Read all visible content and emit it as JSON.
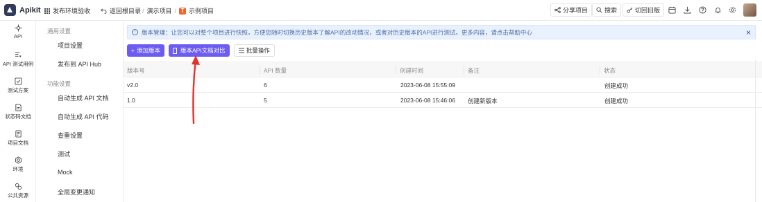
{
  "topbar": {
    "app_name": "Apikit",
    "env": "发布环境验收",
    "back": "返回根目录",
    "breadcrumb": [
      "演示项目",
      "示例项目"
    ],
    "project_badge": "T",
    "share": "分享项目",
    "search": "搜索",
    "old_version": "切回旧版"
  },
  "leftnav": [
    {
      "icon": "api-icon",
      "label": "API"
    },
    {
      "icon": "api-test-case-icon",
      "label": "API 测试用例"
    },
    {
      "icon": "test-plan-icon",
      "label": "测试方案"
    },
    {
      "icon": "status-code-doc-icon",
      "label": "状态码文档"
    },
    {
      "icon": "project-doc-icon",
      "label": "项目文档"
    },
    {
      "icon": "environment-icon",
      "label": "环境"
    },
    {
      "icon": "public-resource-icon",
      "label": "公共资源"
    }
  ],
  "settings": {
    "group1": "通用设置",
    "group1_items": [
      "项目设置",
      "发布到 API Hub"
    ],
    "group2": "功能设置",
    "group2_items": [
      "自动生成 API 文档",
      "自动生成 API 代码",
      "查重设置",
      "测试",
      "Mock",
      "全局变更通知"
    ]
  },
  "banner": {
    "text": "版本管理：让您可以对整个项目进行快照，方便您随时切换历史版本了解API的改动情况，或者对历史版本的API进行测试。更多内容，请点击帮助中心"
  },
  "actions": {
    "add_version": "添加版本",
    "compare": "版本API文档对比",
    "batch": "批量操作"
  },
  "table": {
    "headers": [
      "版本号",
      "API 数量",
      "创建时间",
      "备注",
      "状态"
    ],
    "rows": [
      {
        "version": "v2.0",
        "count": "6",
        "created": "2023-06-08 15:55:09",
        "note": "",
        "status": "创建成功"
      },
      {
        "version": "1.0",
        "count": "5",
        "created": "2023-06-08 15:46:06",
        "note": "创建新版本",
        "status": "创建成功"
      }
    ]
  },
  "colors": {
    "primary": "#6c5cf2",
    "annotation_arrow": "#e8302a",
    "banner_bg": "#eaf1fe"
  }
}
